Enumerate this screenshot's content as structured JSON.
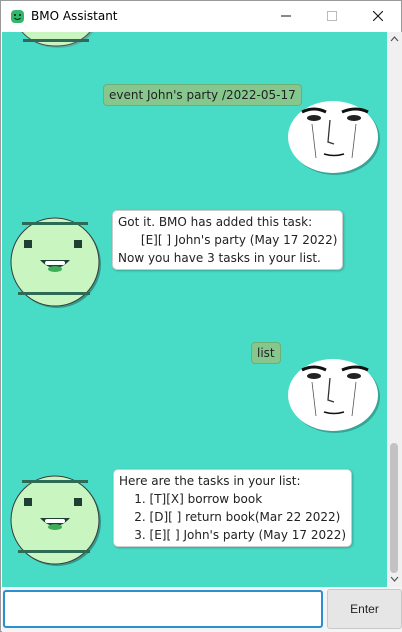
{
  "window": {
    "title": "BMO Assistant",
    "app_icon": "bmo-face-icon",
    "controls": [
      "minimize-icon",
      "maximize-icon",
      "close-icon"
    ]
  },
  "colors": {
    "chat_background": "#48dcc7",
    "user_bubble": "#86c78e",
    "bot_bubble": "#ffffff",
    "bmo_face": "#c8f5c0",
    "input_border": "#2b8fd1"
  },
  "messages": [
    {
      "sender": "user",
      "text": "event John's party /2022-05-17"
    },
    {
      "sender": "bot",
      "text": "Got it. BMO has added this task:\n      [E][ ] John's party (May 17 2022)\nNow you have 3 tasks in your list."
    },
    {
      "sender": "user",
      "text": "list"
    },
    {
      "sender": "bot",
      "text": "Here are the tasks in your list:\n    1. [T][X] borrow book\n    2. [D][ ] return book(Mar 22 2022)\n    3. [E][ ] John's party (May 17 2022)"
    }
  ],
  "input": {
    "value": "",
    "placeholder": ""
  },
  "enter_button": {
    "label": "Enter"
  }
}
